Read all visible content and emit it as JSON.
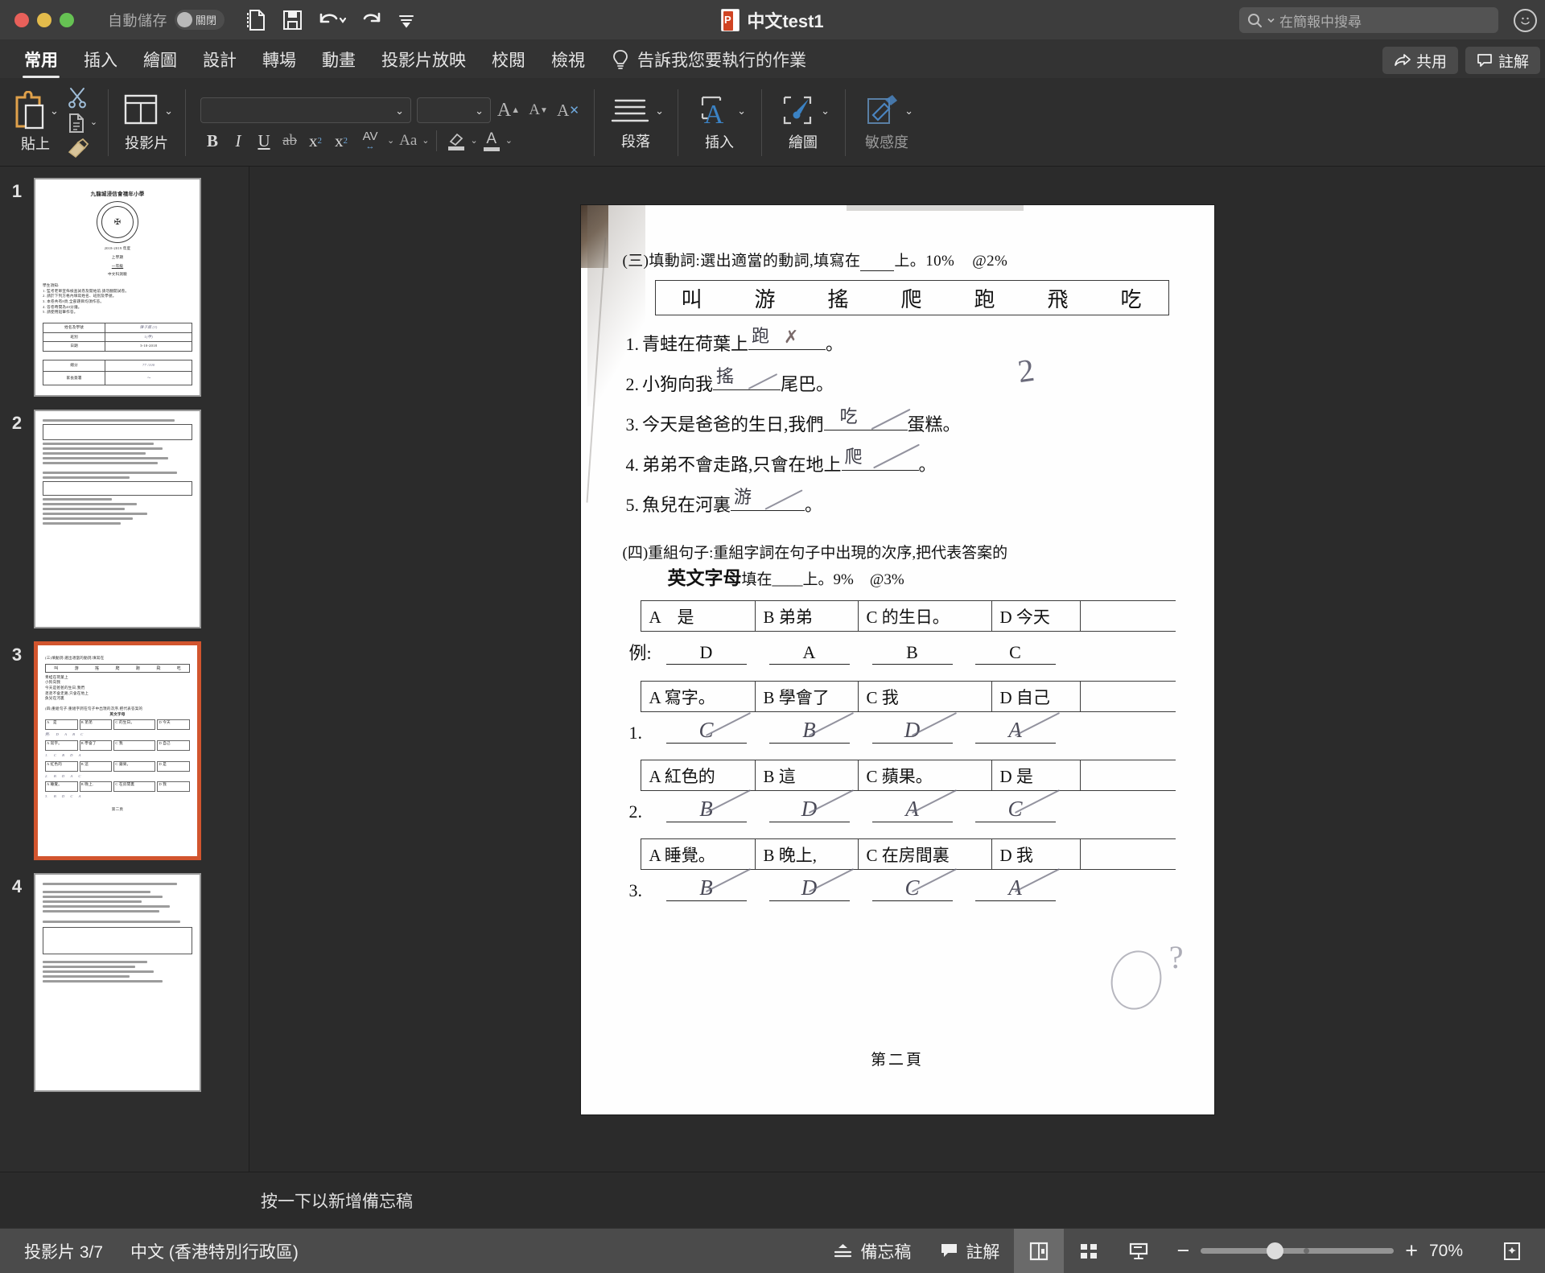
{
  "titlebar": {
    "autosave_label": "自動儲存",
    "autosave_state": "關閉",
    "document_title": "中文test1",
    "pptx_badge": "P",
    "quick_access": [
      {
        "name": "new-from-template-icon",
        "label": "新增"
      },
      {
        "name": "save-icon",
        "label": "儲存"
      },
      {
        "name": "undo-icon",
        "label": "復原"
      },
      {
        "name": "redo-icon",
        "label": "重做"
      },
      {
        "name": "customize-toolbar-icon",
        "label": "自訂工具列"
      }
    ],
    "search_placeholder": "在簡報中搜尋",
    "account_icon": "account-avatar-icon"
  },
  "ribbon": {
    "tabs": [
      {
        "label": "常用",
        "active": true
      },
      {
        "label": "插入",
        "active": false
      },
      {
        "label": "繪圖",
        "active": false
      },
      {
        "label": "設計",
        "active": false
      },
      {
        "label": "轉場",
        "active": false
      },
      {
        "label": "動畫",
        "active": false
      },
      {
        "label": "投影片放映",
        "active": false
      },
      {
        "label": "校閱",
        "active": false
      },
      {
        "label": "檢視",
        "active": false
      }
    ],
    "tell_me": "告訴我您要執行的作業",
    "share_label": "共用",
    "comments_label": "註解",
    "groups": {
      "paste": "貼上",
      "cut_icon": "scissors-icon",
      "copy_icon": "copy-icon",
      "format_painter_icon": "format-painter-icon",
      "slide": "投影片",
      "font_name_value": "",
      "font_size_value": "",
      "bold": "B",
      "italic": "I",
      "underline": "U",
      "strikethrough": "ab",
      "superscript": "x",
      "subscript": "x",
      "char_spacing": "AV",
      "change_case": "Aa",
      "highlight": "highlight-icon",
      "font_color": "A",
      "grow_font": "A",
      "shrink_font": "A",
      "clear_format": "A",
      "paragraph": "段落",
      "insert": "插入",
      "draw": "繪圖",
      "sensitivity": "敏感度"
    }
  },
  "thumbnails": [
    {
      "number": "1",
      "selected": false,
      "kind": "cover",
      "school": "九龍城浸信會禧年小學",
      "year": "2018-2019 年度",
      "term": "上學期",
      "grade": "一年級",
      "subject": "中文科測驗",
      "notice_title": "學生須知:",
      "notice": [
        "1. 監考老師宣佈檢查試卷及開始前,請勿翻開試卷。",
        "2. 請於下列方格內填寫姓名、班別及學號。",
        "3. 本卷共有8頁,全部題目均須作答。",
        "4. 答卷時間為40分鐘。",
        "5. 請使用鉛筆作答。"
      ],
      "table_rows": [
        {
          "label": "姓名及學號",
          "value": "陳子諾  (3)"
        },
        {
          "label": "班別",
          "value": "1(甲)"
        },
        {
          "label": "日期",
          "value": "3-10-2018"
        }
      ],
      "score_rows": [
        {
          "label": "總分",
          "value": "77 /100"
        },
        {
          "label": "家長簽署",
          "value": ""
        }
      ]
    },
    {
      "number": "2",
      "selected": false,
      "kind": "worksheet-p1"
    },
    {
      "number": "3",
      "selected": true,
      "kind": "worksheet-p2"
    },
    {
      "number": "4",
      "selected": false,
      "kind": "worksheet-p3"
    }
  ],
  "slide": {
    "section3": {
      "heading_prefix": "(三)填動詞:選出適當的動詞,填寫在",
      "heading_suffix": "上。10%",
      "heading_marks": "@2%",
      "word_bank": [
        "叫",
        "游",
        "搖",
        "爬",
        "跑",
        "飛",
        "吃"
      ],
      "questions": [
        {
          "num": "1.",
          "before": "青蛙在荷葉上",
          "answer": "跑",
          "mark": "✗",
          "after": "。"
        },
        {
          "num": "2.",
          "before": "小狗向我",
          "answer": "搖",
          "mark": "✓",
          "after": "尾巴。"
        },
        {
          "num": "3.",
          "before": "今天是爸爸的生日,我們",
          "answer": "吃",
          "mark": "✓",
          "after": "蛋糕。"
        },
        {
          "num": "4.",
          "before": "弟弟不會走路,只會在地上",
          "answer": "爬",
          "mark": "✓",
          "after": "。"
        },
        {
          "num": "5.",
          "before": "魚兒在河裏",
          "answer": "游",
          "mark": "✓",
          "after": "。"
        }
      ],
      "teacher_mark": "2"
    },
    "section4": {
      "heading_line1": "(四)重組句子:重組字詞在句子中出現的次序,把代表答案的",
      "heading_line2_bold": "英文字母",
      "heading_line2_rest": "填在____上。9%",
      "heading_marks": "@3%",
      "items": [
        {
          "options": [
            "A　是",
            "B 弟弟",
            "C 的生日。",
            "D 今天"
          ],
          "label": "例:",
          "answers": [
            "D",
            "A",
            "B",
            "C"
          ],
          "is_example": true
        },
        {
          "options": [
            "A 寫字。",
            "B 學會了",
            "C 我",
            "D 自己"
          ],
          "label": "1.",
          "answers": [
            "C",
            "B",
            "D",
            "A"
          ],
          "is_example": false
        },
        {
          "options": [
            "A 紅色的",
            "B 這",
            "C 蘋果。",
            "D 是"
          ],
          "label": "2.",
          "answers": [
            "B",
            "D",
            "A",
            "C"
          ],
          "is_example": false
        },
        {
          "options": [
            "A 睡覺。",
            "B 晚上,",
            "C 在房間裏",
            "D 我"
          ],
          "label": "3.",
          "answers": [
            "B",
            "D",
            "C",
            "A"
          ],
          "is_example": false
        }
      ]
    },
    "page_footer": "第二頁"
  },
  "notes": {
    "placeholder": "按一下以新增備忘稿"
  },
  "statusbar": {
    "slide_count": "投影片 3/7",
    "language": "中文 (香港特別行政區)",
    "notes_label": "備忘稿",
    "comments_label": "註解",
    "views": [
      {
        "name": "normal-view-icon",
        "active": true
      },
      {
        "name": "slide-sorter-view-icon",
        "active": false
      },
      {
        "name": "reading-view-icon",
        "active": false
      }
    ],
    "zoom_out": "−",
    "zoom_in": "+",
    "zoom_level": "70%",
    "fit_slide_icon": "fit-to-window-icon"
  },
  "colors": {
    "accent_orange": "#d2552e",
    "accent_blue": "#4a90d9",
    "titlebar_bg": "#3d3d3d",
    "ribbon_bg": "#2e2e2e",
    "statusbar_bg": "#4b4b4b"
  }
}
